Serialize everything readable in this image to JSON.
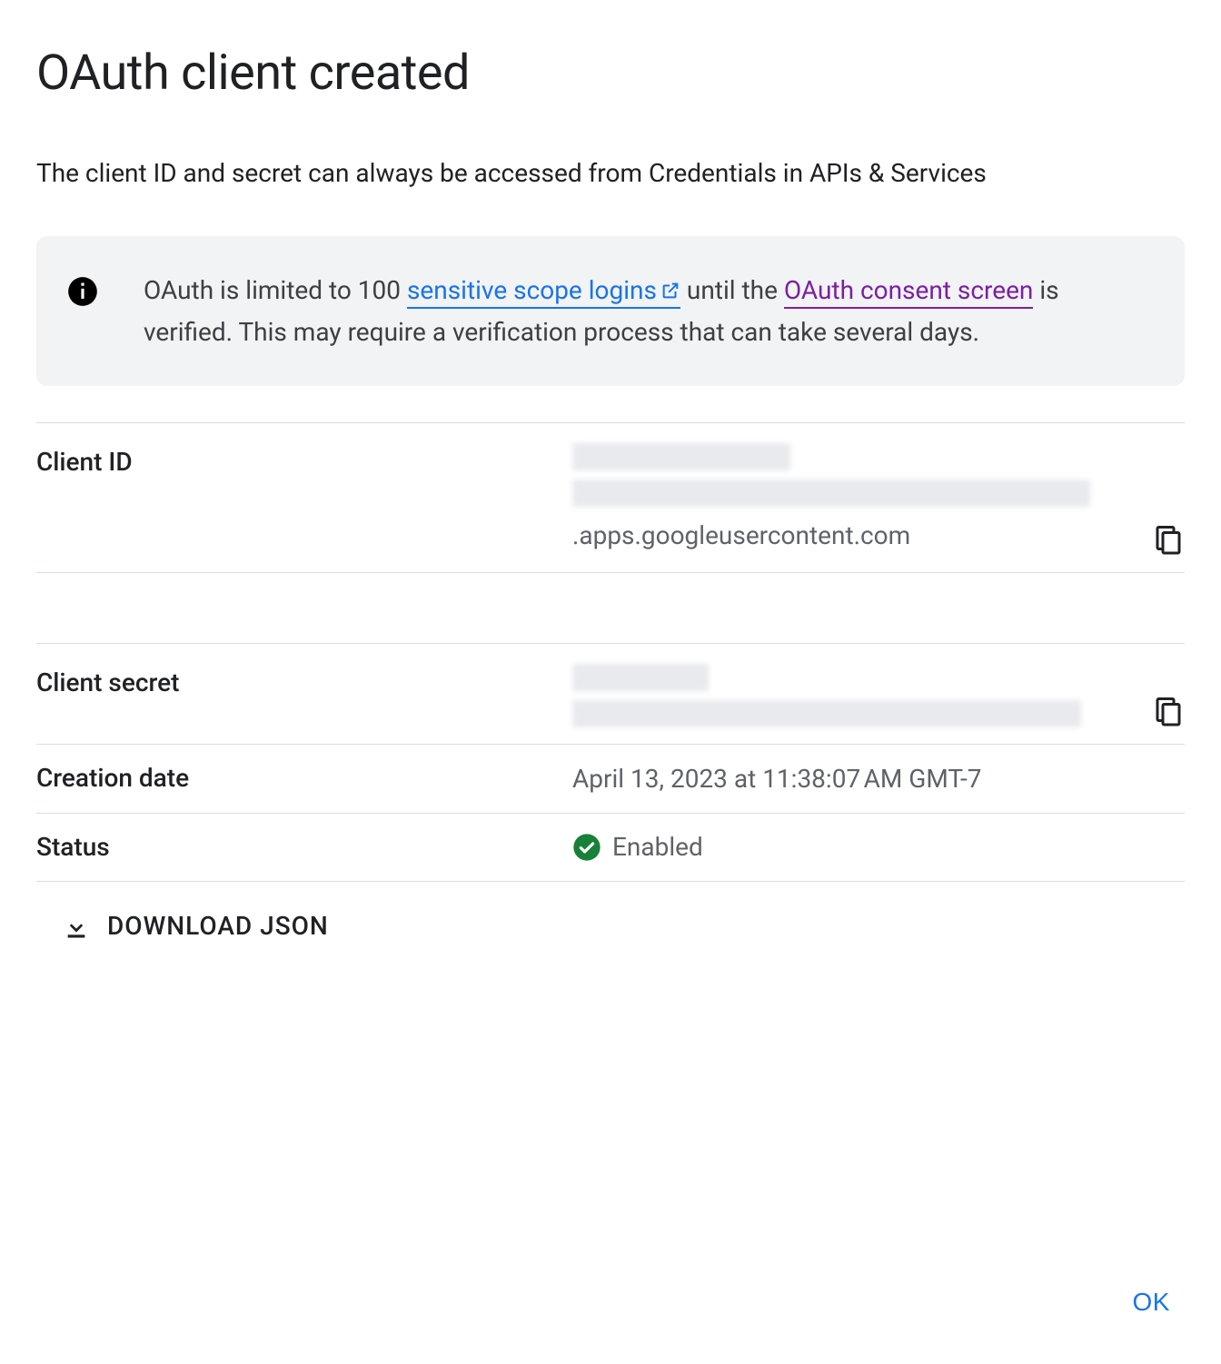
{
  "dialog": {
    "title": "OAuth client created",
    "subtitle": "The client ID and secret can always be accessed from Credentials in APIs & Services",
    "notice": {
      "prefix": "OAuth is limited to 100 ",
      "link1": "sensitive scope logins",
      "mid1": " until the ",
      "link2": "OAuth consent screen",
      "suffix": " is verified. This may require a verification process that can take several days."
    },
    "fields": {
      "client_id_label": "Client ID",
      "client_id_suffix": ".apps.​googleusercontent.com",
      "client_secret_label": "Client secret",
      "creation_date_label": "Creation date",
      "creation_date_value": "April 13, 2023 at 11:38:07 AM GMT-7",
      "status_label": "Status",
      "status_value": "Enabled"
    },
    "download_label": "DOWNLOAD JSON",
    "ok_label": "OK"
  }
}
